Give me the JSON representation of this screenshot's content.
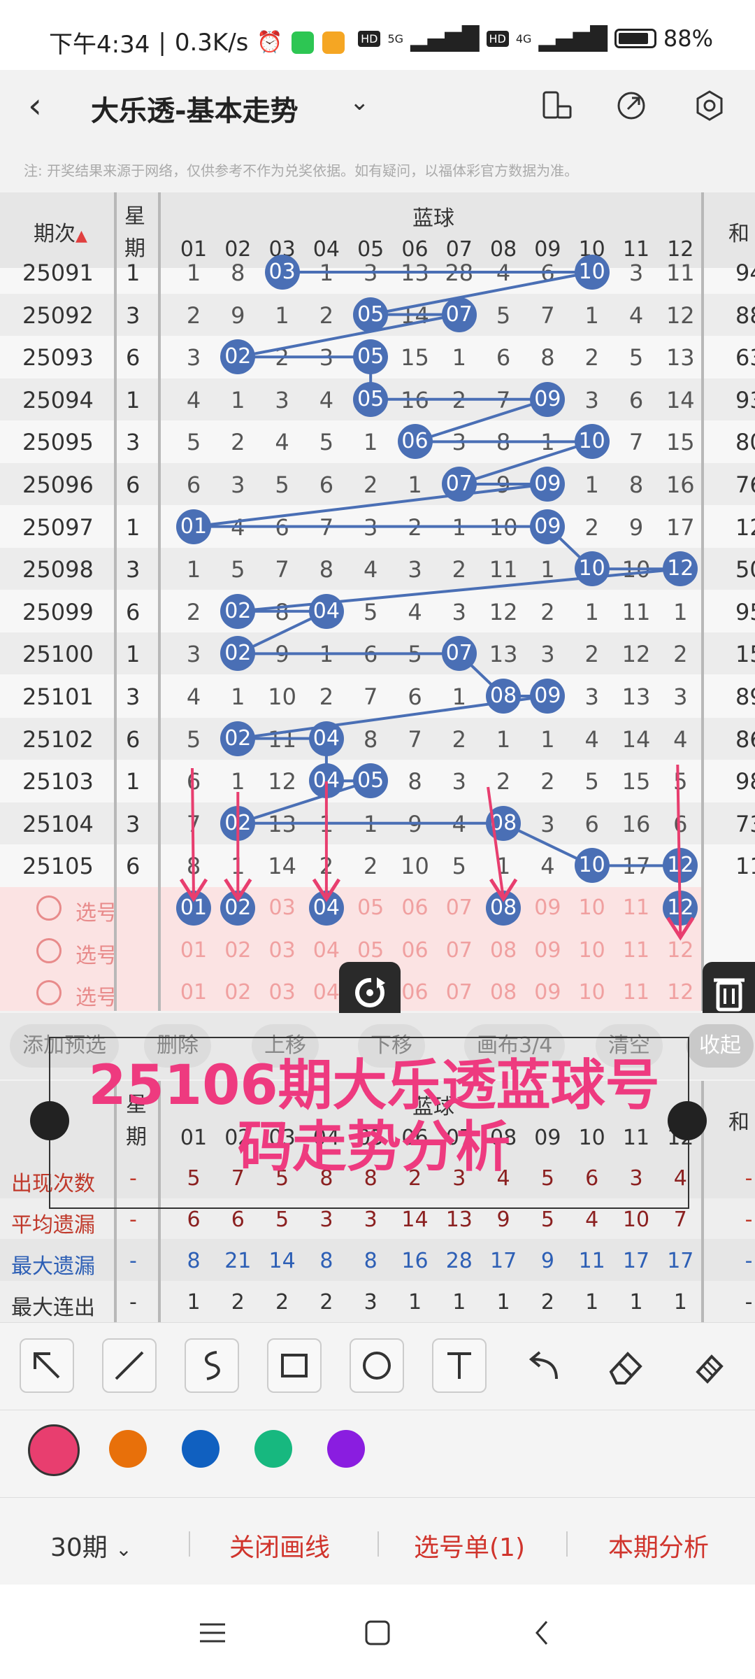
{
  "status": {
    "time": "下午4:34",
    "speed": "0.3K/s",
    "battery": "88%",
    "net1": "5G",
    "net2": "4G",
    "hd": "HD"
  },
  "titlebar": {
    "title": "大乐透-基本走势",
    "back_icon": "back-arrow-icon",
    "drop_icon": "chevron-down-icon"
  },
  "notice": "注: 开奖结果来源于网络，仅供参考不作为兑奖依据。如有疑问，以福体彩官方数据为准。",
  "header": {
    "period_label": "期次",
    "week_label_top": "星",
    "week_label_bottom": "期",
    "group_label": "蓝球",
    "sum_label": "和",
    "numbers": [
      "01",
      "02",
      "03",
      "04",
      "05",
      "06",
      "07",
      "08",
      "09",
      "10",
      "11",
      "12"
    ]
  },
  "rows": [
    {
      "period": "25091",
      "week": "1",
      "cells": [
        "1",
        "8",
        "03",
        "1",
        "3",
        "13",
        "28",
        "4",
        "6",
        "10",
        "3",
        "11"
      ],
      "hits": [
        3,
        10
      ],
      "sum": "94"
    },
    {
      "period": "25092",
      "week": "3",
      "cells": [
        "2",
        "9",
        "1",
        "2",
        "05",
        "14",
        "07",
        "5",
        "7",
        "1",
        "4",
        "12"
      ],
      "hits": [
        5,
        7
      ],
      "sum": "88"
    },
    {
      "period": "25093",
      "week": "6",
      "cells": [
        "3",
        "02",
        "2",
        "3",
        "05",
        "15",
        "1",
        "6",
        "8",
        "2",
        "5",
        "13"
      ],
      "hits": [
        2,
        5
      ],
      "sum": "63"
    },
    {
      "period": "25094",
      "week": "1",
      "cells": [
        "4",
        "1",
        "3",
        "4",
        "05",
        "16",
        "2",
        "7",
        "09",
        "3",
        "6",
        "14"
      ],
      "hits": [
        5,
        9
      ],
      "sum": "93"
    },
    {
      "period": "25095",
      "week": "3",
      "cells": [
        "5",
        "2",
        "4",
        "5",
        "1",
        "06",
        "3",
        "8",
        "1",
        "10",
        "7",
        "15"
      ],
      "hits": [
        6,
        10
      ],
      "sum": "80"
    },
    {
      "period": "25096",
      "week": "6",
      "cells": [
        "6",
        "3",
        "5",
        "6",
        "2",
        "1",
        "07",
        "9",
        "09",
        "1",
        "8",
        "16"
      ],
      "hits": [
        7,
        9
      ],
      "sum": "76"
    },
    {
      "period": "25097",
      "week": "1",
      "cells": [
        "01",
        "4",
        "6",
        "7",
        "3",
        "2",
        "1",
        "10",
        "09",
        "2",
        "9",
        "17"
      ],
      "hits": [
        1,
        9
      ],
      "sum": "12"
    },
    {
      "period": "25098",
      "week": "3",
      "cells": [
        "1",
        "5",
        "7",
        "8",
        "4",
        "3",
        "2",
        "11",
        "1",
        "10",
        "10",
        "12"
      ],
      "hits": [
        10,
        12
      ],
      "sum": "50"
    },
    {
      "period": "25099",
      "week": "6",
      "cells": [
        "2",
        "02",
        "8",
        "04",
        "5",
        "4",
        "3",
        "12",
        "2",
        "1",
        "11",
        "1"
      ],
      "hits": [
        2,
        4
      ],
      "sum": "95"
    },
    {
      "period": "25100",
      "week": "1",
      "cells": [
        "3",
        "02",
        "9",
        "1",
        "6",
        "5",
        "07",
        "13",
        "3",
        "2",
        "12",
        "2"
      ],
      "hits": [
        2,
        7
      ],
      "sum": "15"
    },
    {
      "period": "25101",
      "week": "3",
      "cells": [
        "4",
        "1",
        "10",
        "2",
        "7",
        "6",
        "1",
        "08",
        "09",
        "3",
        "13",
        "3"
      ],
      "hits": [
        8,
        9
      ],
      "sum": "89"
    },
    {
      "period": "25102",
      "week": "6",
      "cells": [
        "5",
        "02",
        "11",
        "04",
        "8",
        "7",
        "2",
        "1",
        "1",
        "4",
        "14",
        "4"
      ],
      "hits": [
        2,
        4
      ],
      "sum": "86"
    },
    {
      "period": "25103",
      "week": "1",
      "cells": [
        "6",
        "1",
        "12",
        "04",
        "05",
        "8",
        "3",
        "2",
        "2",
        "5",
        "15",
        "5"
      ],
      "hits": [
        4,
        5
      ],
      "sum": "98"
    },
    {
      "period": "25104",
      "week": "3",
      "cells": [
        "7",
        "02",
        "13",
        "1",
        "1",
        "9",
        "4",
        "08",
        "3",
        "6",
        "16",
        "6"
      ],
      "hits": [
        2,
        8
      ],
      "sum": "73"
    },
    {
      "period": "25105",
      "week": "6",
      "cells": [
        "8",
        "1",
        "14",
        "2",
        "2",
        "10",
        "5",
        "1",
        "4",
        "10",
        "17",
        "12"
      ],
      "hits": [
        10,
        12
      ],
      "sum": "11"
    }
  ],
  "picks": [
    {
      "label": "选号",
      "nums": [
        "01",
        "02",
        "03",
        "04",
        "05",
        "06",
        "07",
        "08",
        "09",
        "10",
        "11",
        "12"
      ],
      "selected": [
        1,
        2,
        4,
        8,
        12
      ]
    },
    {
      "label": "选号",
      "nums": [
        "01",
        "02",
        "03",
        "04",
        "05",
        "06",
        "07",
        "08",
        "09",
        "10",
        "11",
        "12"
      ],
      "selected": []
    },
    {
      "label": "选号",
      "nums": [
        "01",
        "02",
        "03",
        "04",
        "05",
        "06",
        "07",
        "08",
        "09",
        "10",
        "11",
        "12"
      ],
      "selected": []
    }
  ],
  "toolbar": {
    "add": "添加预选",
    "delete": "删除",
    "up": "上移",
    "down": "下移",
    "canvas": "画布3/4",
    "clear": "清空",
    "collapse": "收起"
  },
  "overlay": {
    "line1": "25106期大乐透蓝球号",
    "line2": "码走势分析"
  },
  "stats": {
    "header_week_top": "星",
    "header_week_bottom": "期",
    "header_group": "蓝球",
    "header_sum": "和",
    "rows": [
      {
        "label": "出现次数",
        "color": "#c0392b",
        "dash": "-",
        "values": [
          "5",
          "7",
          "5",
          "8",
          "8",
          "2",
          "3",
          "4",
          "5",
          "6",
          "3",
          "4"
        ],
        "vcolor": "#8b2020"
      },
      {
        "label": "平均遗漏",
        "color": "#c0392b",
        "dash": "-",
        "values": [
          "6",
          "6",
          "5",
          "3",
          "3",
          "14",
          "13",
          "9",
          "5",
          "4",
          "10",
          "7"
        ],
        "vcolor": "#8b2020"
      },
      {
        "label": "最大遗漏",
        "color": "#2d5fb5",
        "dash": "-",
        "values": [
          "8",
          "21",
          "14",
          "8",
          "8",
          "16",
          "28",
          "17",
          "9",
          "11",
          "17",
          "17"
        ],
        "vcolor": "#2d5fb5"
      },
      {
        "label": "最大连出",
        "color": "#333333",
        "dash": "-",
        "values": [
          "1",
          "2",
          "2",
          "2",
          "3",
          "1",
          "1",
          "1",
          "2",
          "1",
          "1",
          "1"
        ],
        "vcolor": "#333333"
      }
    ]
  },
  "colors": [
    "#e83e6f",
    "#e8700a",
    "#1060c0",
    "#17b87f",
    "#8a1de0"
  ],
  "bottom": {
    "periods": "30期",
    "close_lines": "关闭画线",
    "pick_list": "选号单(1)",
    "analysis": "本期分析"
  }
}
